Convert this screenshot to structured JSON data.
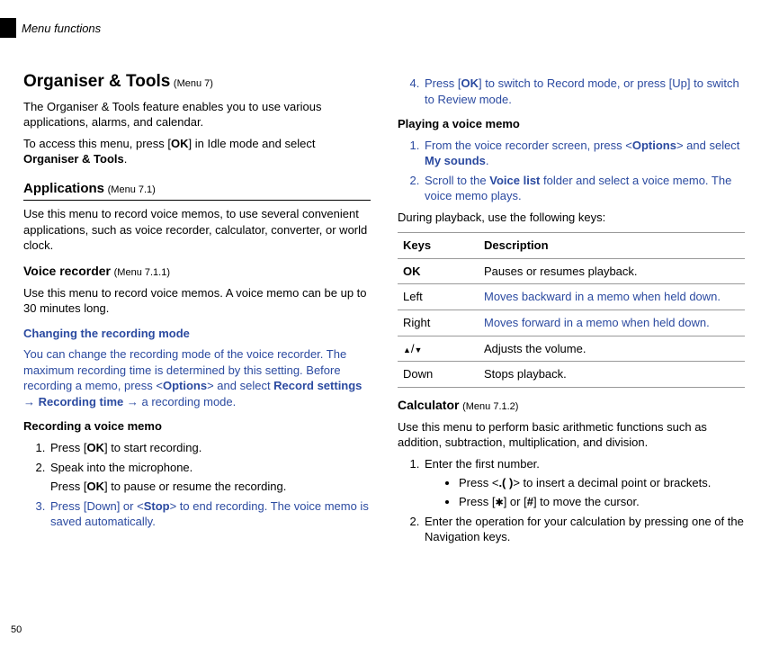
{
  "header": {
    "section_label": "Menu functions"
  },
  "page_number": "50",
  "left": {
    "title": "Organiser & Tools",
    "title_meta": "(Menu 7)",
    "intro": "The Organiser & Tools feature enables you to use various applications, alarms, and calendar.",
    "access_pre": "To access this menu, press [",
    "access_ok": "OK",
    "access_mid": "] in Idle mode and select ",
    "access_bold": "Organiser & Tools",
    "access_post": ".",
    "apps_title": "Applications",
    "apps_meta": "(Menu 7.1)",
    "apps_desc": "Use this menu to record voice memos, to use several convenient applications, such as voice recorder, calculator, converter, or world clock.",
    "vr_title": "Voice recorder",
    "vr_meta": "(Menu 7.1.1)",
    "vr_desc": "Use this menu to record voice memos. A voice memo can be up to 30 minutes long.",
    "chg_title": "Changing the recording mode",
    "chg_p1a": "You can change the recording mode of the voice recorder. The maximum recording time is determined by this setting. Before recording a memo, press <",
    "chg_p1_opt": "Options",
    "chg_p1b": "> and select ",
    "chg_p1_rec": "Record settings",
    "chg_p1_arrow": " → ",
    "chg_p1_time": "Recording time",
    "chg_p1c": " → a recording mode.",
    "rec_title": "Recording a voice memo",
    "steps": {
      "s1a": "Press [",
      "s1_ok": "OK",
      "s1b": "] to start recording.",
      "s2": "Speak into the microphone.",
      "s2_sub_a": "Press [",
      "s2_sub_ok": "OK",
      "s2_sub_b": "] to pause or resume the recording.",
      "s3a": "Press [Down] or <",
      "s3_stop": "Stop",
      "s3b": "> to end recording. The voice memo is saved automatically."
    }
  },
  "right": {
    "s4a": "Press [",
    "s4_ok": "OK",
    "s4b": "] to switch to Record mode, or press [Up] to switch to Review mode.",
    "play_title": "Playing a voice memo",
    "p1a": "From the voice recorder screen, press <",
    "p1_opt": "Options",
    "p1b": "> and select ",
    "p1_ms": "My sounds",
    "p1c": ".",
    "p2a": "Scroll to the ",
    "p2_vl": "Voice list",
    "p2b": " folder and select a voice memo. The voice memo plays.",
    "during": "During playback, use the following keys:",
    "table": {
      "h1": "Keys",
      "h2": "Description",
      "r1k": "OK",
      "r1d": "Pauses or resumes playback.",
      "r2k": "Left",
      "r2d": "Moves backward in a memo when held down.",
      "r3k": "Right",
      "r3d": "Moves forward in a memo when held down.",
      "r4d": "Adjusts the volume.",
      "r5k": "Down",
      "r5d": "Stops playback."
    },
    "calc_title": "Calculator",
    "calc_meta": "(Menu 7.1.2)",
    "calc_desc": "Use this menu to perform basic arithmetic functions such as addition, subtraction, multiplication, and division.",
    "c1": "Enter the first number.",
    "c1_b1a": "Press <",
    "c1_b1_dot": ".( )",
    "c1_b1b": "> to insert a decimal point or brackets.",
    "c1_b2a": "Press [",
    "c1_b2b": "] or [",
    "c1_b2c": "] to move the cursor.",
    "c2": "Enter the operation for your calculation by pressing one of the Navigation keys."
  }
}
